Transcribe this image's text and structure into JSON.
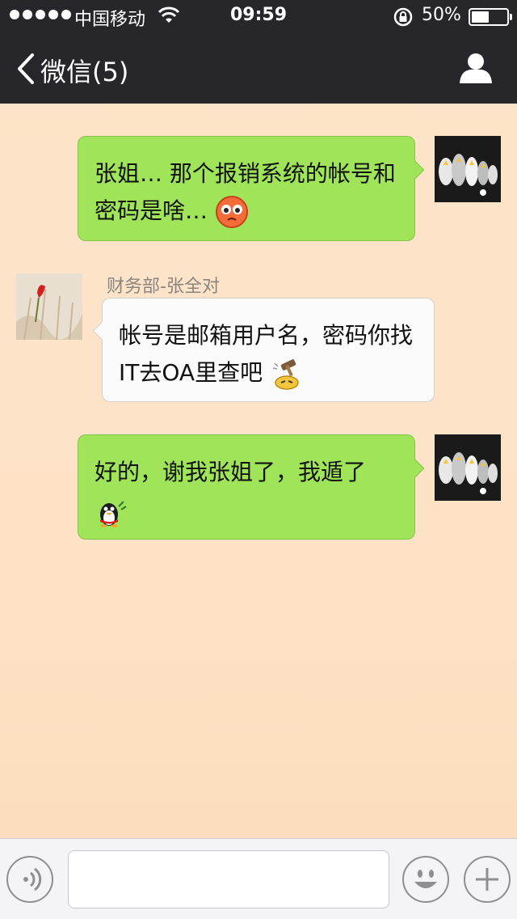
{
  "status_bar": {
    "carrier": "中国移动",
    "time": "09:59",
    "battery": "50%",
    "battery_level": 0.5
  },
  "nav": {
    "back_label": "微信(5)"
  },
  "messages": [
    {
      "from": "me",
      "text": "张姐… 那个报销系统的帐号和",
      "text2": "密码是啥…",
      "emoji": "blush-worried-emoji"
    },
    {
      "from": "other",
      "sender": "财务部-张全对",
      "text": "帐号是邮箱用户名，密码你找",
      "text2": "IT去OA里查吧",
      "emoji": "hammer-head-emoji"
    },
    {
      "from": "me",
      "text": "好的，谢我张姐了，我遁了",
      "emoji": "penguin-waving-emoji"
    }
  ],
  "input_bar": {
    "voice_icon": "voice-icon",
    "emoji_icon": "smiley-icon",
    "more_icon": "plus-icon",
    "placeholder": ""
  },
  "colors": {
    "nav_bg": "#27272b",
    "my_bubble": "#9fe459",
    "their_bubble": "#fbfbfb"
  }
}
